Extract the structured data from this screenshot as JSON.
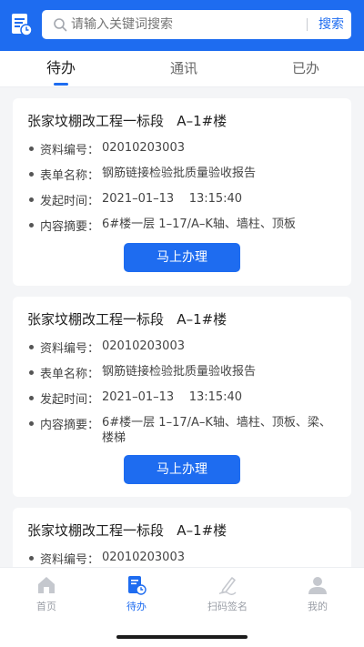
{
  "colors": {
    "accent": "#1e6cf0",
    "background": "#f4f5f7",
    "inactive": "#9a9ea6"
  },
  "header": {
    "app_icon": "document-clock-icon",
    "search": {
      "placeholder": "请输入关键词搜索",
      "button": "搜索"
    }
  },
  "tabs": [
    {
      "label": "待办",
      "active": true
    },
    {
      "label": "通讯",
      "active": false
    },
    {
      "label": "已办",
      "active": false
    }
  ],
  "tasks": [
    {
      "title": "张家坟棚改工程一标段   A–1#楼",
      "fields": [
        {
          "label": "资料编号：",
          "value": "02010203003"
        },
        {
          "label": "表单名称：",
          "value": "钢筋链接检验批质量验收报告"
        },
        {
          "label": "发起时间：",
          "value": "2021–01–13    13:15:40"
        },
        {
          "label": "内容摘要：",
          "value": "6#楼一层 1–17/A–K轴、墙柱、顶板"
        }
      ],
      "action": "马上办理"
    },
    {
      "title": "张家坟棚改工程一标段   A–1#楼",
      "fields": [
        {
          "label": "资料编号：",
          "value": "02010203003"
        },
        {
          "label": "表单名称：",
          "value": "钢筋链接检验批质量验收报告"
        },
        {
          "label": "发起时间：",
          "value": "2021–01–13    13:15:40"
        },
        {
          "label": "内容摘要：",
          "value": "6#楼一层 1–17/A–K轴、墙柱、顶板、梁、\n楼梯"
        }
      ],
      "action": "马上办理"
    },
    {
      "title": "张家坟棚改工程一标段   A–1#楼",
      "fields": [
        {
          "label": "资料编号：",
          "value": "02010203003"
        }
      ]
    }
  ],
  "bottom_nav": [
    {
      "label": "首页",
      "icon": "home-icon",
      "active": false
    },
    {
      "label": "待办",
      "icon": "todo-document-icon",
      "active": true
    },
    {
      "label": "扫码签名",
      "icon": "sign-pen-icon",
      "active": false
    },
    {
      "label": "我的",
      "icon": "user-icon",
      "active": false
    }
  ]
}
